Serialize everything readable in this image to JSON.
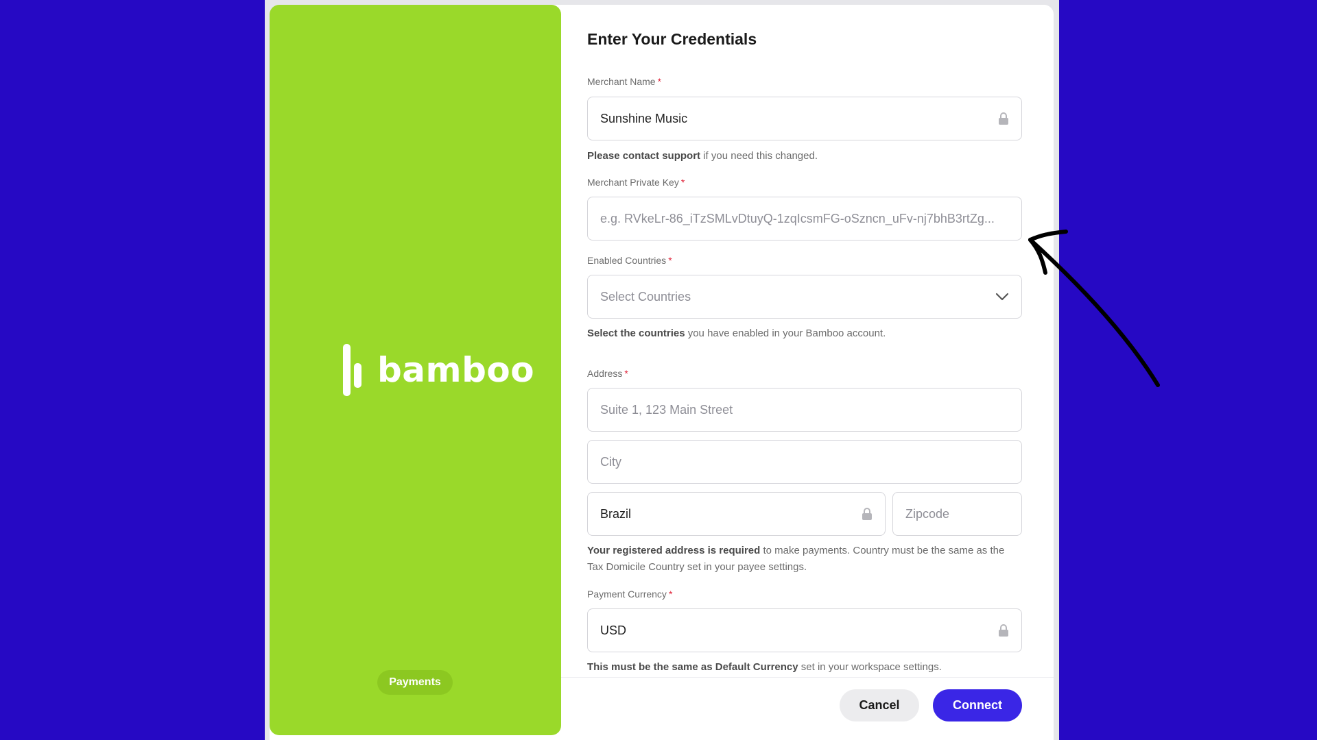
{
  "brand": {
    "name": "bamboo",
    "tag": "Payments",
    "panel_color": "#9ad92a"
  },
  "form": {
    "title": "Enter Your Credentials",
    "merchant_name": {
      "label": "Merchant Name",
      "required": "*",
      "value": "Sunshine Music",
      "locked": true,
      "hint_bold": "Please contact support",
      "hint_rest": " if you need this changed."
    },
    "private_key": {
      "label": "Merchant Private Key",
      "required": "*",
      "placeholder": "e.g. RVkeLr-86_iTzSMLvDtuyQ-1zqIcsmFG-oSzncn_uFv-nj7bhB3rtZg..."
    },
    "countries": {
      "label": "Enabled Countries",
      "required": "*",
      "placeholder": "Select Countries",
      "icon": "chevron-down-icon",
      "hint_bold": "Select the countries",
      "hint_rest": " you have enabled in your Bamboo account."
    },
    "address": {
      "label": "Address",
      "required": "*",
      "street_placeholder": "Suite 1, 123 Main Street",
      "city_placeholder": "City",
      "country_value": "Brazil",
      "zip_placeholder": "Zipcode",
      "hint_bold": "Your registered address is required",
      "hint_rest": " to make payments. Country must be the same as the Tax Domicile Country set in your payee settings."
    },
    "currency": {
      "label": "Payment Currency",
      "required": "*",
      "value": "USD",
      "locked": true,
      "hint_bold": "This must be the same as Default Currency",
      "hint_rest": " set in your workspace settings."
    }
  },
  "actions": {
    "cancel_label": "Cancel",
    "connect_label": "Connect",
    "connect_color": "#3a26e6"
  },
  "colors": {
    "background": "#2609c4",
    "required": "#e0243a"
  }
}
